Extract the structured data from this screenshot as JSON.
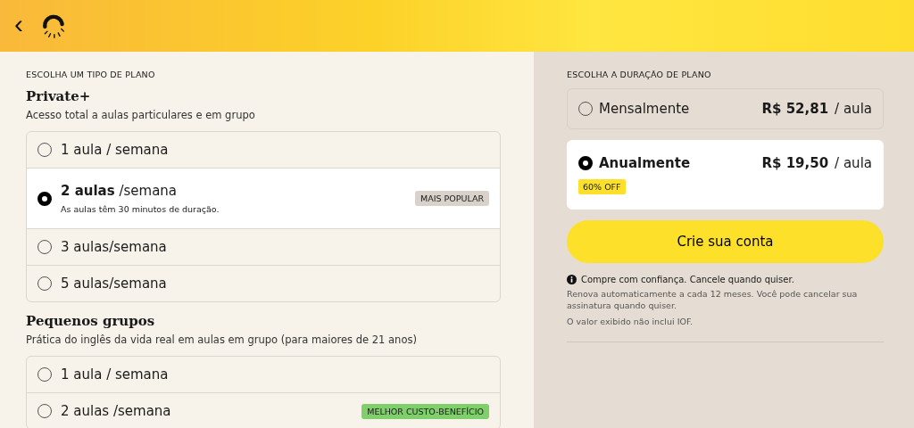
{
  "header": {
    "back": "‹"
  },
  "plan_type": {
    "label": "ESCOLHA UM TIPO DE PLANO",
    "groups": [
      {
        "title": "Private+",
        "subtitle": "Acesso total a aulas particulares e em grupo",
        "options": [
          {
            "label": "1 aula / semana",
            "selected": false
          },
          {
            "label": "**2 aulas** /semana",
            "note": "As aulas têm 30 minutos de duração.",
            "badge": {
              "text": "MAIS POPULAR",
              "kind": "neutral"
            },
            "selected": true
          },
          {
            "label": "3 aulas/semana",
            "selected": false
          },
          {
            "label": "5 aulas/semana",
            "selected": false
          }
        ]
      },
      {
        "title": "Pequenos grupos",
        "subtitle": "Prática do inglês da vida real em aulas em grupo (para maiores de 21 anos)",
        "options": [
          {
            "label": "1 aula / semana",
            "selected": false
          },
          {
            "label": "2 aulas /semana",
            "badge": {
              "text": "MELHOR CUSTO-BENEFÍCIO",
              "kind": "green"
            },
            "selected": false
          }
        ]
      }
    ]
  },
  "duration": {
    "label": "ESCOLHA A DURAÇÃO DE PLANO",
    "options": [
      {
        "label": "Mensalmente",
        "price": "R$ 52,81",
        "unit": "/ aula",
        "selected": false
      },
      {
        "label": "Anualmente",
        "price": "R$ 19,50",
        "unit": "/ aula",
        "discount": "60% OFF",
        "selected": true
      }
    ]
  },
  "cta": "Crie sua conta",
  "notice": {
    "title": "Compre com confiança. Cancele quando quiser.",
    "lines": [
      "Renova automaticamente a cada 12 meses. Você pode cancelar sua assinatura quando quiser.",
      "O valor exibido não inclui IOF."
    ]
  }
}
